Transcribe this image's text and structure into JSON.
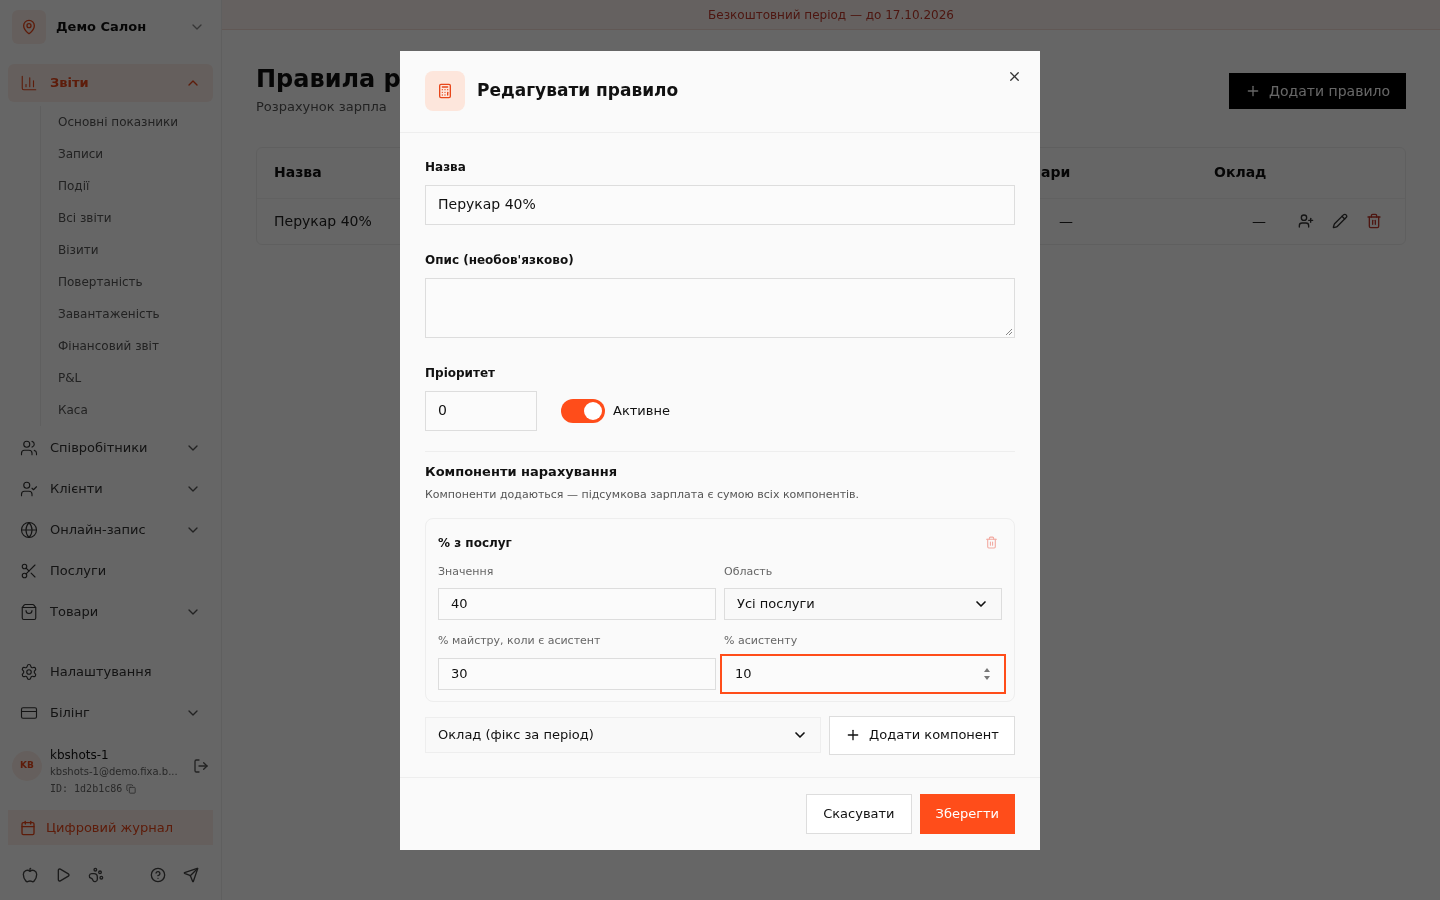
{
  "banner": "Безкоштовний період — до 17.10.2026",
  "sidebar": {
    "salon": "Демо Салон",
    "items": [
      {
        "kind": "group",
        "label": "Звіти",
        "expanded": true,
        "selected": true,
        "children": [
          {
            "label": "Основні показники"
          },
          {
            "label": "Записи"
          },
          {
            "label": "Події"
          },
          {
            "label": "Всі звіти"
          },
          {
            "label": "Візити"
          },
          {
            "label": "Повертаність"
          },
          {
            "label": "Завантаженість"
          },
          {
            "label": "Фінансовий звіт"
          },
          {
            "label": "P&L"
          },
          {
            "label": "Каса"
          }
        ]
      },
      {
        "kind": "group",
        "label": "Співробітники",
        "expanded": false,
        "selected": false
      },
      {
        "kind": "group",
        "label": "Клієнти",
        "expanded": false,
        "selected": false
      },
      {
        "kind": "group",
        "label": "Онлайн-запис",
        "expanded": false,
        "selected": false
      },
      {
        "kind": "link",
        "label": "Послуги",
        "selected": false
      },
      {
        "kind": "group",
        "label": "Товари",
        "expanded": false,
        "selected": false
      }
    ],
    "bottom_items": [
      {
        "kind": "link",
        "label": "Налаштування",
        "selected": false
      },
      {
        "kind": "group",
        "label": "Білінг",
        "expanded": false,
        "selected": false
      }
    ],
    "user": {
      "initials": "KB",
      "name": "kbshots-1",
      "email": "kbshots-1@demo.fixa.b...",
      "id": "ID: 1d2b1c86"
    },
    "journal": "Цифровий журнал"
  },
  "page": {
    "title": "Правила р",
    "subtitle": "Розрахунок зарпла",
    "add_button": "Додати правило",
    "table": {
      "columns": [
        "Назва",
        "ари",
        "Оклад"
      ],
      "rows": [
        {
          "cells": [
            "Перукар 40%",
            "—",
            "—"
          ]
        }
      ]
    }
  },
  "modal": {
    "title": "Редагувати правило",
    "name_label": "Назва",
    "name_value": "Перукар 40%",
    "description_label": "Опис (необов'язково)",
    "priority_label": "Пріоритет",
    "priority_value": "0",
    "active": {
      "label": "Активне",
      "on": true
    },
    "components_title": "Компоненти нарахування",
    "components_hint": "Компоненти додаються — підсумкова зарплата є сумою всіх компонентів.",
    "component": {
      "title": "% з послуг",
      "fields": [
        {
          "kind": "input",
          "label": "Значення",
          "value": "40",
          "focused": false
        },
        {
          "kind": "select",
          "label": "Область",
          "value": "Усі послуги",
          "focused": false
        },
        {
          "kind": "input",
          "label": "% майстру, коли є асистент",
          "value": "30",
          "focused": false
        },
        {
          "kind": "input",
          "label": "% асистенту",
          "value": "10",
          "focused": true
        }
      ]
    },
    "add_select": "Оклад (фікс за період)",
    "add_button": "Додати компонент",
    "cancel": "Скасувати",
    "save": "Зберегти"
  }
}
